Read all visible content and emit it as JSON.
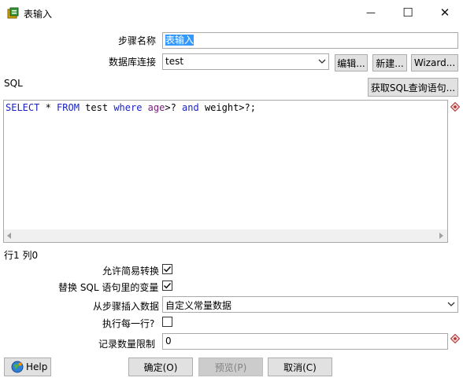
{
  "window": {
    "title": "表输入",
    "minimize_glyph": "—",
    "maximize_glyph": "☐",
    "close_glyph": "✕"
  },
  "form": {
    "step_name_label": "步骤名称",
    "step_name_value": "表输入",
    "connection_label": "数据库连接",
    "connection_value": "test",
    "edit_button": "编辑...",
    "new_button": "新建...",
    "wizard_button": "Wizard...",
    "sql_label": "SQL",
    "get_sql_button": "获取SQL查询语句...",
    "sql": {
      "t1": "SELECT",
      "t2": " * ",
      "t3": "FROM",
      "t4": " test ",
      "t5": "where",
      "t6": " ",
      "t7": "age",
      "t8": ">? ",
      "t9": "and",
      "t10": " weight>?;"
    },
    "cursor_position": "行1 列0",
    "allow_lazy_conversion_label": "允许简易转换",
    "allow_lazy_conversion": true,
    "replace_variables_label": "替换 SQL 语句里的变量",
    "replace_variables": true,
    "insert_from_step_label": "从步骤插入数据",
    "insert_from_step_value": "自定义常量数据",
    "execute_each_row_label": "执行每一行?",
    "execute_each_row": false,
    "limit_label": "记录数量限制",
    "limit_value": "0"
  },
  "footer": {
    "help_button": "Help",
    "ok_button": "确定(O)",
    "preview_button": "预览(P)",
    "cancel_button": "取消(C)"
  },
  "icons": {
    "app": "table-input-icon",
    "help": "help-globe-icon",
    "variable": "variable-diamond-icon"
  },
  "colors": {
    "selection": "#3399ff",
    "keyword": "#1b22c2",
    "field": "#7a1a7a"
  }
}
